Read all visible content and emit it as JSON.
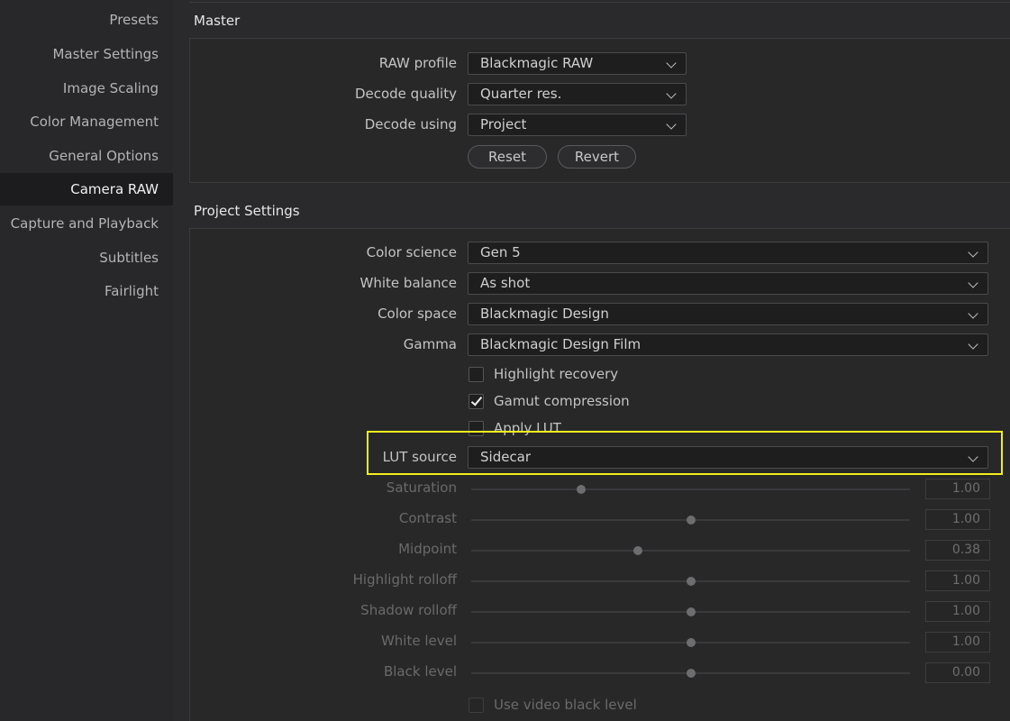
{
  "sidebar": {
    "items": [
      {
        "label": "Presets"
      },
      {
        "label": "Master Settings"
      },
      {
        "label": "Image Scaling"
      },
      {
        "label": "Color Management"
      },
      {
        "label": "General Options"
      },
      {
        "label": "Camera RAW",
        "active": true
      },
      {
        "label": "Capture and Playback"
      },
      {
        "label": "Subtitles"
      },
      {
        "label": "Fairlight"
      }
    ]
  },
  "master": {
    "title": "Master",
    "raw_profile": {
      "label": "RAW profile",
      "value": "Blackmagic RAW"
    },
    "decode_quality": {
      "label": "Decode quality",
      "value": "Quarter res."
    },
    "decode_using": {
      "label": "Decode using",
      "value": "Project"
    },
    "reset_label": "Reset",
    "revert_label": "Revert"
  },
  "project": {
    "title": "Project Settings",
    "color_science": {
      "label": "Color science",
      "value": "Gen 5"
    },
    "white_balance": {
      "label": "White balance",
      "value": "As shot"
    },
    "color_space": {
      "label": "Color space",
      "value": "Blackmagic Design"
    },
    "gamma": {
      "label": "Gamma",
      "value": "Blackmagic Design Film"
    },
    "highlight_recovery": {
      "label": "Highlight recovery",
      "checked": false
    },
    "gamut_compression": {
      "label": "Gamut compression",
      "checked": true
    },
    "apply_lut": {
      "label": "Apply LUT",
      "checked": false
    },
    "lut_source": {
      "label": "LUT source",
      "value": "Sidecar"
    },
    "sliders": [
      {
        "label": "Saturation",
        "value": "1.00",
        "level": 0.25
      },
      {
        "label": "Contrast",
        "value": "1.00",
        "level": 0.5
      },
      {
        "label": "Midpoint",
        "value": "0.38",
        "level": 0.38
      },
      {
        "label": "Highlight rolloff",
        "value": "1.00",
        "level": 0.5
      },
      {
        "label": "Shadow rolloff",
        "value": "1.00",
        "level": 0.5
      },
      {
        "label": "White level",
        "value": "1.00",
        "level": 0.5
      },
      {
        "label": "Black level",
        "value": "0.00",
        "level": 0.5
      }
    ],
    "use_video_black_level": {
      "label": "Use video black level",
      "checked": false
    }
  },
  "colors": {
    "highlight_box": "#f2ef1b"
  }
}
